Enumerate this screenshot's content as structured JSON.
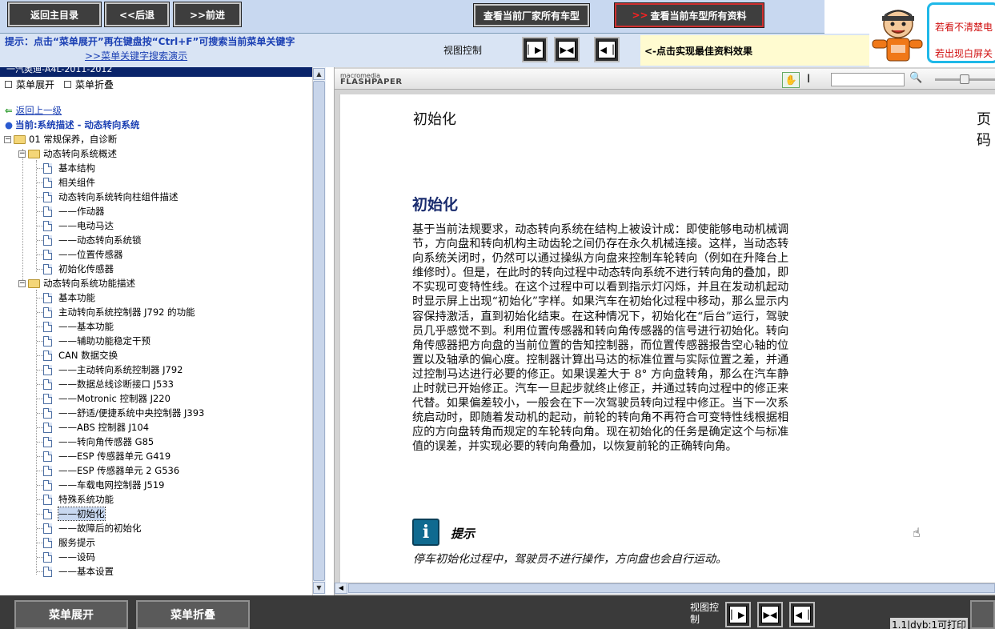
{
  "top_nav": {
    "home_label": "返回主目录",
    "back_label": "<<后退",
    "forward_label": ">>前进",
    "factory_models_label": "查看当前厂家所有车型",
    "model_docs_label": "查看当前车型所有资料",
    "model_docs_arrow": ">>"
  },
  "hint": {
    "text": "提示：点击“菜单展开”再在键盘按“Ctrl+F”可搜索当前菜单关键字",
    "demo_link": ">>菜单关键字搜索演示",
    "view_control_label": "视图控制",
    "best_effect": "<-点击实现最佳资料效果"
  },
  "banner": {
    "line1": "若看不清楚电",
    "line2": "若出现白屏关"
  },
  "tree": {
    "header": "一汽奥迪-A4L-2011-2012",
    "expand_label": "菜单展开",
    "collapse_label": "菜单折叠",
    "back_up": "返回上一级",
    "current": "当前:系统描述 - 动态转向系统",
    "root": "01 常规保养，自诊断",
    "folder1": "动态转向系统概述",
    "folder1_items": [
      "基本结构",
      "相关组件",
      "动态转向系统转向柱组件描述",
      "——作动器",
      "——电动马达",
      "——动态转向系统锁",
      "——位置传感器",
      "初始化传感器"
    ],
    "folder2": "动态转向系统功能描述",
    "folder2_items": [
      "基本功能",
      "主动转向系统控制器 J792 的功能",
      "——基本功能",
      "——辅助功能稳定干预",
      "CAN 数据交换",
      "——主动转向系统控制器 J792",
      "——数据总线诊断接口 J533",
      "——Motronic 控制器 J220",
      "——舒适/便捷系统中央控制器 J393",
      "——ABS 控制器 J104",
      "——转向角传感器 G85",
      "——ESP 传感器单元 G419",
      "——ESP 传感器单元 2 G536",
      "——车载电网控制器 J519",
      "特殊系统功能",
      "——初始化",
      "——故障后的初始化",
      "服务提示",
      "——设码",
      "——基本设置"
    ],
    "selected_index": 15
  },
  "viewer": {
    "logo_top": "macromedia",
    "logo_bottom": "FLASHPAPER",
    "page_header": "初始化",
    "page_corner": "页码",
    "title": "初始化",
    "body": "基于当前法规要求，动态转向系统在结构上被设计成：即使能够电动机械调节，方向盘和转向机构主动齿轮之间仍存在永久机械连接。这样，当动态转向系统关闭时，仍然可以通过操纵方向盘来控制车轮转向（例如在升降台上维修时）。但是，在此时的转向过程中动态转向系统不进行转向角的叠加，即不实现可变特性线。在这个过程中可以看到指示灯闪烁，并且在发动机起动时显示屏上出现“初始化”字样。如果汽车在初始化过程中移动，那么显示内容保持激活，直到初始化结束。在这种情况下，初始化在“后台”运行，驾驶员几乎感觉不到。利用位置传感器和转向角传感器的信号进行初始化。转向角传感器把方向盘的当前位置的告知控制器，而位置传感器报告空心轴的位置以及轴承的偏心度。控制器计算出马达的标准位置与实际位置之差，并通过控制马达进行必要的修正。如果误差大于 8° 方向盘转角，那么在汽车静止时就已开始修正。汽车一旦起步就终止修正，并通过转向过程中的修正来代替。如果偏差较小，一般会在下一次驾驶员转向过程中修正。当下一次系统启动时，即随着发动机的起动，前轮的转向角不再符合可变特性线根据相应的方向盘转角而规定的车轮转向角。现在初始化的任务是确定这个与标准值的误差，并实现必要的转向角叠加，以恢复前轮的正确转向角。",
    "tip_icon": "i",
    "tip_title": "提示",
    "tip_text": "停车初始化过程中，驾驶员不进行操作，方向盘也会自行运动。"
  },
  "bottom": {
    "expand_label": "菜单展开",
    "collapse_label": "菜单折叠",
    "view_control_label": "视图控制",
    "status": "1.1|dyb:1可打印"
  },
  "colors": {
    "nav_bg": "#3e3e3e",
    "hint_blue": "#1a3fb3",
    "doc_title": "#1a2c6e",
    "cyan_border": "#1fb8e8",
    "red_text": "#d01010"
  }
}
